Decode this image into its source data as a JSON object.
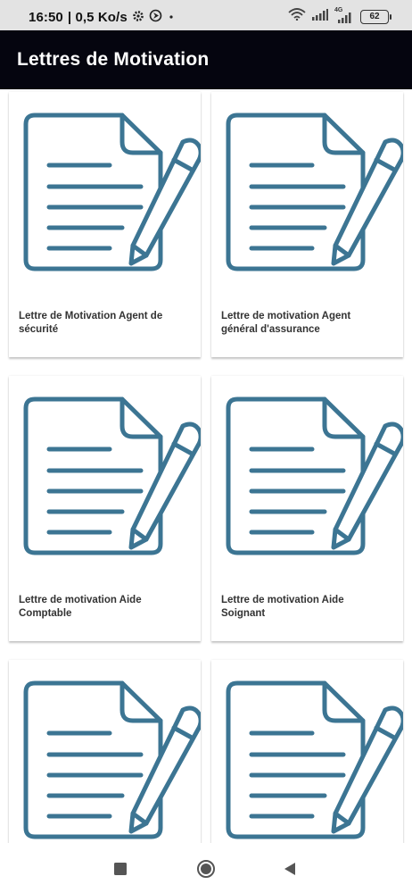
{
  "status_bar": {
    "time": "16:50",
    "speed": "| 0,5 Ko/s",
    "network": "4G",
    "battery": "62",
    "icons": [
      "gear-icon",
      "navigation-icon",
      "dot-icon",
      "wifi-icon",
      "signal-icon",
      "signal-4g-icon",
      "battery-icon"
    ]
  },
  "app_bar": {
    "title": "Lettres de Motivation"
  },
  "cards": [
    {
      "label": "Lettre de Motivation Agent de sécurité",
      "icon": "document-pencil-icon"
    },
    {
      "label": "Lettre de motivation Agent général d'assurance",
      "icon": "document-pencil-icon"
    },
    {
      "label": "Lettre de motivation Aide Comptable",
      "icon": "document-pencil-icon"
    },
    {
      "label": "Lettre de motivation Aide Soignant",
      "icon": "document-pencil-icon"
    },
    {
      "label": "",
      "icon": "document-pencil-icon"
    },
    {
      "label": "",
      "icon": "document-pencil-icon"
    }
  ],
  "nav_bar": {
    "icons": [
      "recents-square-icon",
      "home-circle-icon",
      "back-triangle-icon"
    ]
  },
  "colors": {
    "icon_stroke": "#3c7593",
    "app_bar": "#05050f",
    "status_bar": "#e3e3e3"
  }
}
